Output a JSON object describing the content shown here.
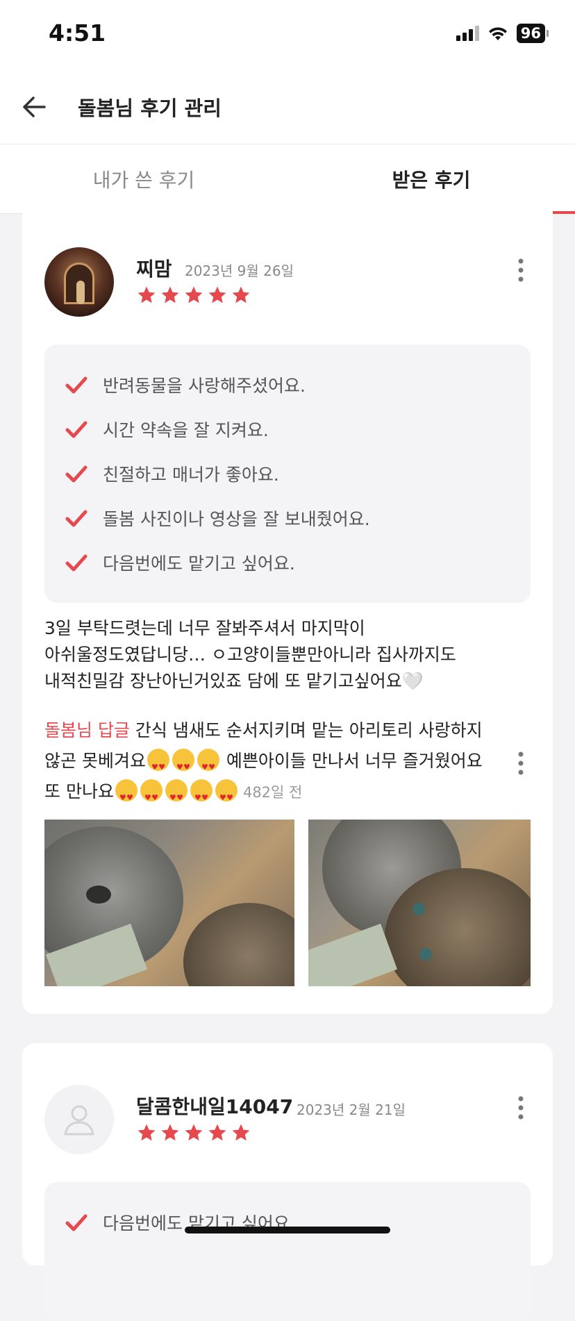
{
  "status_bar": {
    "time": "4:51",
    "battery": "96"
  },
  "header": {
    "title": "돌봄님 후기 관리"
  },
  "tabs": [
    {
      "label": "내가 쓴 후기",
      "active": false
    },
    {
      "label": "받은 후기",
      "active": true
    }
  ],
  "reviews": [
    {
      "name": "찌맘",
      "date": "2023년 9월 26일",
      "rating": 5,
      "checklist": [
        "반려동물을 사랑해주셨어요.",
        "시간 약속을 잘 지켜요.",
        "친절하고 매너가 좋아요.",
        "돌봄 사진이나 영상을 잘 보내줬어요.",
        "다음번에도 맡기고 싶어요."
      ],
      "text": "3일 부탁드렷는데 너무 잘봐주셔서 마지막이 아쉬울정도였답니당… ㅇ고양이들뿐만아니라 집사까지도 내적친밀감 장난아닌거있죠 담에 또 맡기고싶어요🤍",
      "reply": {
        "label": "돌봄님 답글",
        "text_part1": "간식 냄새도 순서지키며 맡는 아리토리 사랑하지않곤 못베겨요",
        "text_part2": " 예쁜아이들 만나서 너무 즐거웠어요 또 만나요",
        "ago": "482일 전"
      }
    },
    {
      "name": "달콤한내일14047",
      "date": "2023년 2월 21일",
      "rating": 5,
      "checklist": [
        "다음번에도 맡기고 싶어요."
      ]
    }
  ],
  "colors": {
    "accent": "#e5484d",
    "star": "#e5484d"
  },
  "icons": {
    "back": "arrow-left-icon",
    "more": "more-vertical-icon",
    "check": "check-icon",
    "star": "star-icon",
    "user": "user-placeholder-icon"
  }
}
